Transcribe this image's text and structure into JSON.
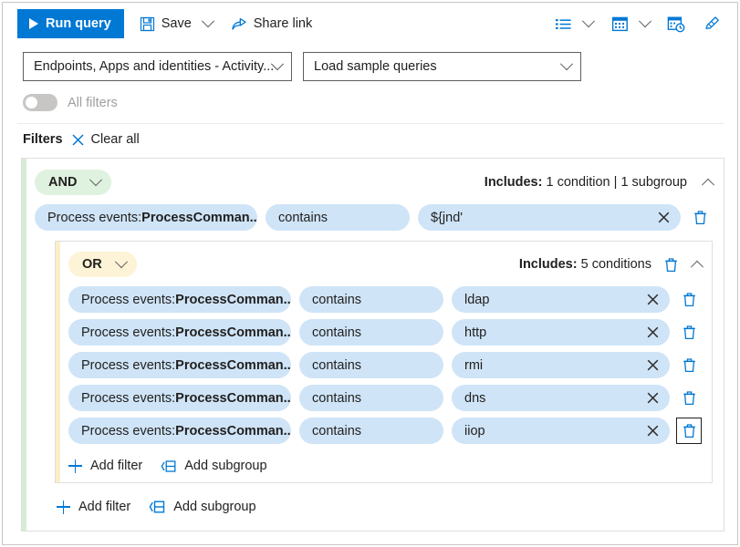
{
  "toolbar": {
    "run_query": "Run query",
    "save": "Save",
    "share_link": "Share link"
  },
  "selectors": {
    "scope": "Endpoints, Apps and identities - Activity...",
    "samples": "Load sample queries"
  },
  "all_filters": {
    "label": "All filters",
    "enabled": false
  },
  "filters_header": {
    "title": "Filters",
    "clear_all": "Clear all"
  },
  "colors": {
    "accent_blue": "#0078d4",
    "and_pill_bg": "#dff2df",
    "and_accent": "#d7ecd7",
    "or_pill_bg": "#fdf3d7",
    "or_accent": "#fbeec9",
    "chip_bg": "#cfe4f7"
  },
  "group": {
    "operator": "AND",
    "includes_label": "Includes:",
    "includes_value": "1 condition | 1 subgroup",
    "conditions": [
      {
        "field": "Process events: ",
        "field_bold": "ProcessComman...",
        "operator": "contains",
        "value": "${jnd'",
        "trash_focused": false
      }
    ],
    "add_filter": "Add filter",
    "add_subgroup": "Add subgroup"
  },
  "subgroup": {
    "operator": "OR",
    "includes_label": "Includes:",
    "includes_value": "5 conditions",
    "conditions": [
      {
        "field": "Process events: ",
        "field_bold": "ProcessComman...",
        "operator": "contains",
        "value": "ldap",
        "trash_focused": false
      },
      {
        "field": "Process events: ",
        "field_bold": "ProcessComman...",
        "operator": "contains",
        "value": "http",
        "trash_focused": false
      },
      {
        "field": "Process events: ",
        "field_bold": "ProcessComman...",
        "operator": "contains",
        "value": "rmi",
        "trash_focused": false
      },
      {
        "field": "Process events: ",
        "field_bold": "ProcessComman...",
        "operator": "contains",
        "value": "dns",
        "trash_focused": false
      },
      {
        "field": "Process events: ",
        "field_bold": "ProcessComman...",
        "operator": "contains",
        "value": "iiop",
        "trash_focused": true
      }
    ],
    "add_filter": "Add filter",
    "add_subgroup": "Add subgroup"
  }
}
